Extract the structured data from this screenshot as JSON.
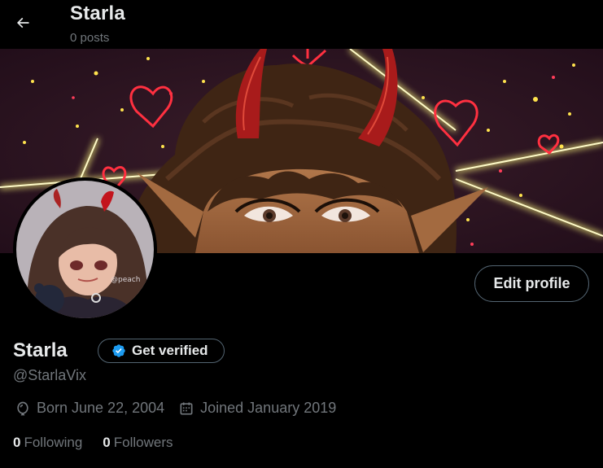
{
  "header": {
    "name": "Starla",
    "posts": "0 posts"
  },
  "profile": {
    "display_name": "Starla",
    "verify_label": "Get verified",
    "handle": "@StarlaVix",
    "edit_label": "Edit profile",
    "born": "Born June 22, 2004",
    "joined": "Joined January 2019",
    "following_count": "0",
    "following_label": "Following",
    "followers_count": "0",
    "followers_label": "Followers"
  },
  "avatar": {
    "watermark": "@peach"
  },
  "icons": {
    "back": "arrow-left-icon",
    "verified": "verified-badge-icon",
    "birthday": "balloon-icon",
    "calendar": "calendar-icon"
  },
  "colors": {
    "background": "#000000",
    "text": "#e7e9ea",
    "muted": "#71767b",
    "border": "#536471",
    "verified_blue": "#1d9bf0"
  }
}
